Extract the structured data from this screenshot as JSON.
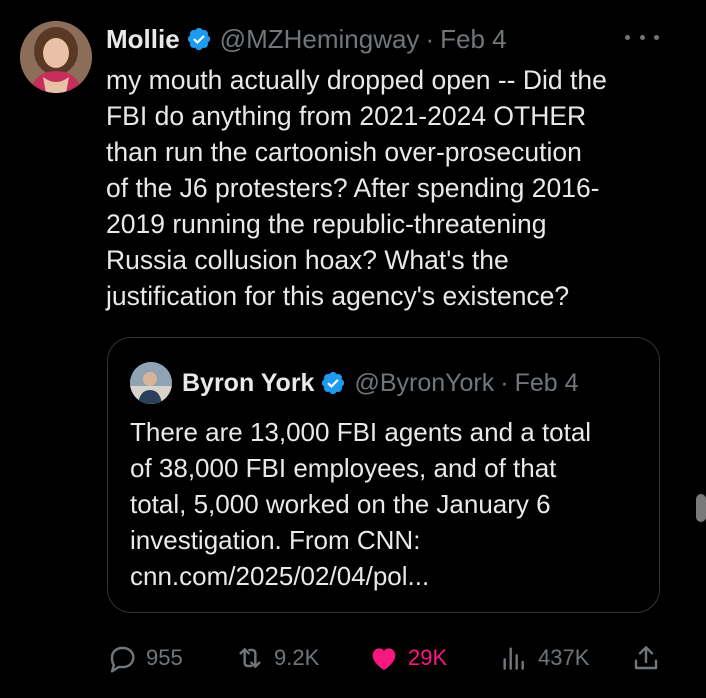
{
  "author": {
    "name": "Mollie",
    "handle": "@MZHemingway",
    "separator": "·",
    "date": "Feb 4",
    "text": "my mouth actually dropped open -- Did the\nFBI do anything from 2021-2024 OTHER\nthan run the cartoonish over-prosecution\nof the J6 protesters? After spending 2016-\n2019 running the republic-threatening\nRussia collusion hoax? What's the\njustification for this agency's existence?"
  },
  "quoted": {
    "name": "Byron York",
    "handle": "@ByronYork",
    "separator": "·",
    "date": "Feb 4",
    "text": "There are 13,000 FBI agents and a total\nof 38,000 FBI employees, and of that\ntotal, 5,000 worked on the January 6\ninvestigation. From CNN:\ncnn.com/2025/02/04/pol..."
  },
  "actions": {
    "replies": "955",
    "reposts": "9.2K",
    "likes": "29K",
    "views": "437K"
  },
  "colors": {
    "background": "#000000",
    "text": "#e7e9ea",
    "muted": "#71767b",
    "verified": "#1d9bf0",
    "like": "#f91880",
    "border": "#2f3336"
  }
}
